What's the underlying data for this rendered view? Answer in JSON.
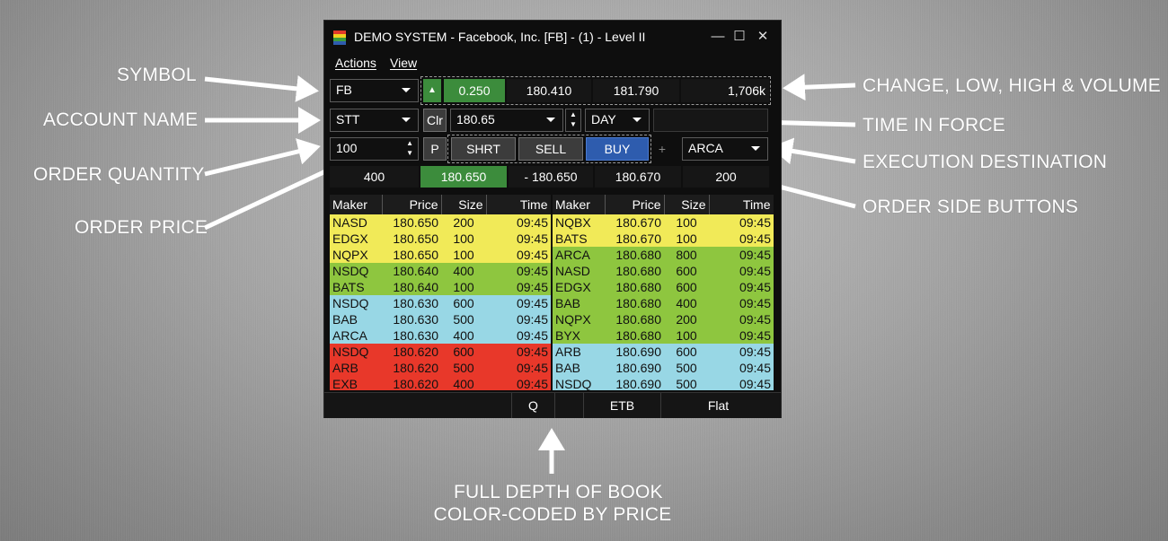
{
  "window": {
    "title": "DEMO SYSTEM - Facebook, Inc. [FB] - (1) - Level II",
    "minimize": "—",
    "maximize": "☐",
    "close": "✕"
  },
  "menu": {
    "actions": "Actions",
    "view": "View"
  },
  "row1": {
    "symbol": "FB",
    "change": "0.250",
    "low": "180.410",
    "high": "181.790",
    "volume": "1,706k"
  },
  "row2": {
    "account": "STT",
    "clr": "Clr",
    "price": "180.65",
    "tif": "DAY"
  },
  "row3": {
    "quantity": "100",
    "p": "P",
    "short": "SHRT",
    "sell": "SELL",
    "buy": "BUY",
    "plus": "+",
    "destination": "ARCA"
  },
  "row4": {
    "bid_size": "400",
    "bid": "180.650",
    "spread": "- 180.650",
    "ask": "180.670",
    "ask_size": "200"
  },
  "book_headers": {
    "maker": "Maker",
    "price": "Price",
    "size": "Size",
    "time": "Time"
  },
  "bids": [
    {
      "maker": "NASD",
      "price": "180.650",
      "size": "200",
      "time": "09:45",
      "color": "yellow"
    },
    {
      "maker": "EDGX",
      "price": "180.650",
      "size": "100",
      "time": "09:45",
      "color": "yellow"
    },
    {
      "maker": "NQPX",
      "price": "180.650",
      "size": "100",
      "time": "09:45",
      "color": "yellow"
    },
    {
      "maker": "NSDQ",
      "price": "180.640",
      "size": "400",
      "time": "09:45",
      "color": "green"
    },
    {
      "maker": "BATS",
      "price": "180.640",
      "size": "100",
      "time": "09:45",
      "color": "green"
    },
    {
      "maker": "NSDQ",
      "price": "180.630",
      "size": "600",
      "time": "09:45",
      "color": "blue"
    },
    {
      "maker": "BAB",
      "price": "180.630",
      "size": "500",
      "time": "09:45",
      "color": "blue"
    },
    {
      "maker": "ARCA",
      "price": "180.630",
      "size": "400",
      "time": "09:45",
      "color": "blue"
    },
    {
      "maker": "NSDQ",
      "price": "180.620",
      "size": "600",
      "time": "09:45",
      "color": "red"
    },
    {
      "maker": "ARB",
      "price": "180.620",
      "size": "500",
      "time": "09:45",
      "color": "red"
    },
    {
      "maker": "EXB",
      "price": "180.620",
      "size": "400",
      "time": "09:45",
      "color": "red"
    }
  ],
  "asks": [
    {
      "maker": "NQBX",
      "price": "180.670",
      "size": "100",
      "time": "09:45",
      "color": "yellow"
    },
    {
      "maker": "BATS",
      "price": "180.670",
      "size": "100",
      "time": "09:45",
      "color": "yellow"
    },
    {
      "maker": "ARCA",
      "price": "180.680",
      "size": "800",
      "time": "09:45",
      "color": "green"
    },
    {
      "maker": "NASD",
      "price": "180.680",
      "size": "600",
      "time": "09:45",
      "color": "green"
    },
    {
      "maker": "EDGX",
      "price": "180.680",
      "size": "600",
      "time": "09:45",
      "color": "green"
    },
    {
      "maker": "BAB",
      "price": "180.680",
      "size": "400",
      "time": "09:45",
      "color": "green"
    },
    {
      "maker": "NQPX",
      "price": "180.680",
      "size": "200",
      "time": "09:45",
      "color": "green"
    },
    {
      "maker": "BYX",
      "price": "180.680",
      "size": "100",
      "time": "09:45",
      "color": "green"
    },
    {
      "maker": "ARB",
      "price": "180.690",
      "size": "600",
      "time": "09:45",
      "color": "blue"
    },
    {
      "maker": "BAB",
      "price": "180.690",
      "size": "500",
      "time": "09:45",
      "color": "blue"
    },
    {
      "maker": "NSDQ",
      "price": "180.690",
      "size": "500",
      "time": "09:45",
      "color": "blue"
    }
  ],
  "status": {
    "q": "Q",
    "etb": "ETB",
    "flat": "Flat"
  },
  "callouts": {
    "symbol": "SYMBOL",
    "account": "ACCOUNT NAME",
    "quantity": "ORDER QUANTITY",
    "price": "ORDER PRICE",
    "change": "CHANGE, LOW, HIGH & VOLUME",
    "tif": "TIME IN FORCE",
    "destination": "EXECUTION DESTINATION",
    "side": "ORDER SIDE BUTTONS",
    "depth_line1": "FULL DEPTH OF BOOK",
    "depth_line2": "COLOR-CODED BY PRICE"
  },
  "colors": {
    "yellow": "#f1ea58",
    "green": "#8ec63f",
    "blue": "#98d7e5",
    "red": "#e8382a",
    "buy": "#2e5cae",
    "accent_green": "#3c8c3c"
  },
  "icons": {
    "dropdown": "chevron-down-icon",
    "up": "arrow-up-icon",
    "spinner": "spinner-icon"
  }
}
